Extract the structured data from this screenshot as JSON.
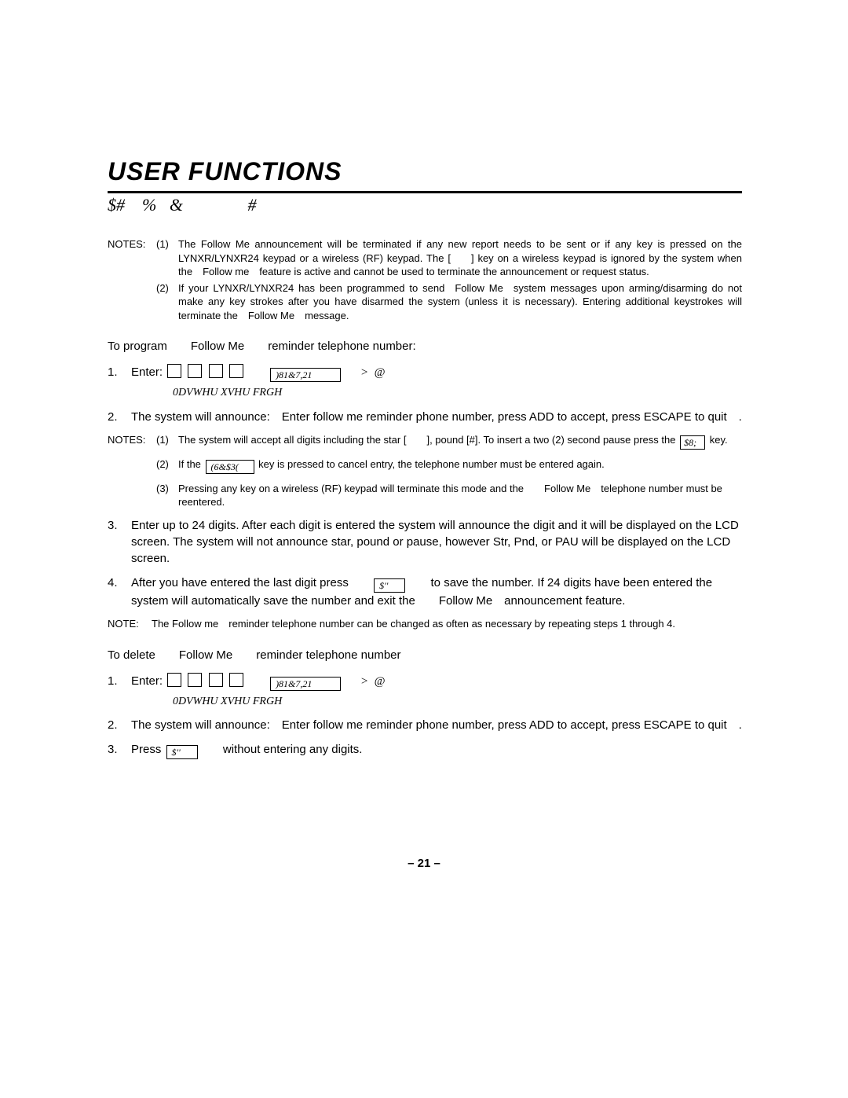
{
  "title": "USER FUNCTIONS",
  "subtitle": "$#    %   &               #",
  "notes_top": {
    "label": "NOTES:",
    "items": [
      {
        "num": "(1)",
        "text": "The Follow Me announcement will be terminated if any new report needs to be sent or if any key is pressed on the LYNXR/LYNXR24 keypad or a wireless (RF) keypad. The [  ] key on a wireless keypad is ignored by the system when the Follow me feature is active and cannot be used to terminate the announcement or request status."
      },
      {
        "num": "(2)",
        "text": "If your LYNXR/LYNXR24 has been programmed to send Follow Me system messages upon arming/disarming do not make any key strokes after you have disarmed the system (unless it is necessary). Entering additional keystrokes will terminate the Follow Me message."
      }
    ]
  },
  "program_line": "To program  Follow Me  reminder telephone number:",
  "prog_steps": {
    "s1": {
      "no": "1.",
      "enter": "Enter:",
      "function_key": ")81&7,21",
      "after": "     >  @",
      "master": "0DVWHU XVHU FRGH"
    },
    "s2": {
      "no": "2.",
      "text": "The system will announce: Enter follow me reminder phone number, press ADD to accept, press ESCAPE to quit ."
    },
    "s3": {
      "no": "3.",
      "text": "Enter up to 24 digits. After each digit is entered the system will announce the digit and it will be displayed on the LCD screen. The system will not announce star, pound or pause, however Str, Pnd, or PAU will be displayed on the LCD screen."
    },
    "s4": {
      "no": "4.",
      "pre": "After you have entered the last digit press",
      "key": "$''",
      "post": "to save the number. If 24 digits have been entered the system will automatically save the number and exit the  Follow Me announcement feature."
    }
  },
  "notes_inner": {
    "label": "NOTES:",
    "items": [
      {
        "num": "(1)",
        "pre": "The system will accept all digits including the star [  ], pound [#]. To insert a two (2) second pause press the",
        "key": "$8;",
        "post": "key."
      },
      {
        "num": "(2)",
        "pre": "If the",
        "key": "(6&$3(",
        "post": "key is pressed to cancel entry, the telephone number must be entered again."
      },
      {
        "num": "(3)",
        "text": "Pressing any key on a wireless (RF) keypad will terminate this mode and the  Follow Me telephone number must be reentered."
      }
    ]
  },
  "note_final": {
    "label": "NOTE:",
    "text": "The Follow me reminder telephone number can be changed as often as necessary by repeating steps 1 through 4."
  },
  "delete_line": "To delete  Follow Me  reminder telephone number",
  "del_steps": {
    "s1": {
      "no": "1.",
      "enter": "Enter:",
      "function_key": ")81&7,21",
      "after": "     >  @",
      "master": "0DVWHU XVHU FRGH"
    },
    "s2": {
      "no": "2.",
      "text": "The system will announce: Enter follow me reminder phone number, press ADD to accept, press ESCAPE to quit ."
    },
    "s3": {
      "no": "3.",
      "pre": "Press",
      "key": "$''",
      "post": "without entering any digits."
    }
  },
  "pagenum": "– 21 –"
}
